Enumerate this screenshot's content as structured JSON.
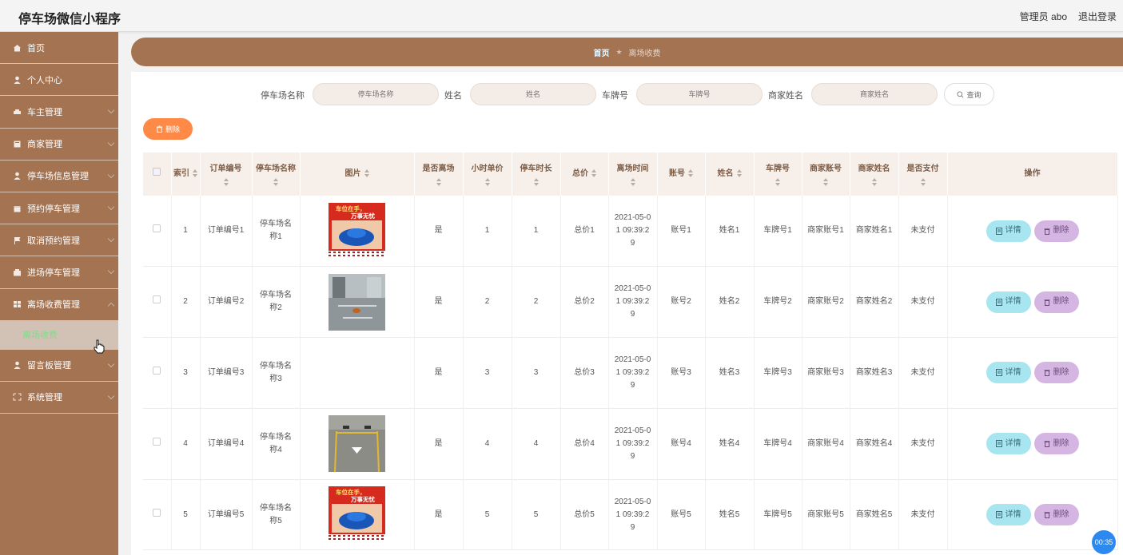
{
  "header": {
    "app_title": "停车场微信小程序",
    "admin_label": "管理员 abo",
    "logout_label": "退出登录"
  },
  "sidebar": {
    "items": [
      {
        "label": "首页",
        "icon": "home-icon"
      },
      {
        "label": "个人中心",
        "icon": "user-icon"
      },
      {
        "label": "车主管理",
        "icon": "car-icon"
      },
      {
        "label": "商家管理",
        "icon": "shop-icon"
      },
      {
        "label": "停车场信息管理",
        "icon": "user-icon"
      },
      {
        "label": "预约停车管理",
        "icon": "calendar-icon"
      },
      {
        "label": "取消预约管理",
        "icon": "flag-icon"
      },
      {
        "label": "进场停车管理",
        "icon": "building-icon"
      },
      {
        "label": "离场收费管理",
        "icon": "grid-icon"
      },
      {
        "label": "留言板管理",
        "icon": "user-icon"
      },
      {
        "label": "系统管理",
        "icon": "settings-icon"
      }
    ],
    "submenu_label": "离场收费"
  },
  "breadcrumb": {
    "home": "首页",
    "separator": "★",
    "current": "离场收费"
  },
  "search": {
    "fields": [
      {
        "label": "停车场名称",
        "placeholder": "停车场名称"
      },
      {
        "label": "姓名",
        "placeholder": "姓名"
      },
      {
        "label": "车牌号",
        "placeholder": "车牌号"
      },
      {
        "label": "商家姓名",
        "placeholder": "商家姓名"
      }
    ],
    "query_label": "查询"
  },
  "toolbar": {
    "delete_label": "删除"
  },
  "table": {
    "columns": [
      "索引",
      "订单编号",
      "停车场名称",
      "图片",
      "是否离场",
      "小时单价",
      "停车时长",
      "总价",
      "离场时间",
      "账号",
      "姓名",
      "车牌号",
      "商家账号",
      "商家姓名",
      "是否支付",
      "操作"
    ],
    "detail_label": "详情",
    "delete_label": "删除",
    "rows": [
      {
        "index": "1",
        "order_no": "订单编号1",
        "lot_name": "停车场名称1",
        "image": "promo",
        "left": "是",
        "unit_price": "1",
        "duration": "1",
        "total": "总价1",
        "leave_time": "2021-05-01 09:39:29",
        "account": "账号1",
        "name": "姓名1",
        "plate": "车牌号1",
        "merchant_account": "商家账号1",
        "merchant_name": "商家姓名1",
        "paid": "未支付"
      },
      {
        "index": "2",
        "order_no": "订单编号2",
        "lot_name": "停车场名称2",
        "image": "garage",
        "left": "是",
        "unit_price": "2",
        "duration": "2",
        "total": "总价2",
        "leave_time": "2021-05-01 09:39:29",
        "account": "账号2",
        "name": "姓名2",
        "plate": "车牌号2",
        "merchant_account": "商家账号2",
        "merchant_name": "商家姓名2",
        "paid": "未支付"
      },
      {
        "index": "3",
        "order_no": "订单编号3",
        "lot_name": "停车场名称3",
        "image": "none",
        "left": "是",
        "unit_price": "3",
        "duration": "3",
        "total": "总价3",
        "leave_time": "2021-05-01 09:39:29",
        "account": "账号3",
        "name": "姓名3",
        "plate": "车牌号3",
        "merchant_account": "商家账号3",
        "merchant_name": "商家姓名3",
        "paid": "未支付"
      },
      {
        "index": "4",
        "order_no": "订单编号4",
        "lot_name": "停车场名称4",
        "image": "spot",
        "left": "是",
        "unit_price": "4",
        "duration": "4",
        "total": "总价4",
        "leave_time": "2021-05-01 09:39:29",
        "account": "账号4",
        "name": "姓名4",
        "plate": "车牌号4",
        "merchant_account": "商家账号4",
        "merchant_name": "商家姓名4",
        "paid": "未支付"
      },
      {
        "index": "5",
        "order_no": "订单编号5",
        "lot_name": "停车场名称5",
        "image": "promo",
        "left": "是",
        "unit_price": "5",
        "duration": "5",
        "total": "总价5",
        "leave_time": "2021-05-01 09:39:29",
        "account": "账号5",
        "name": "姓名5",
        "plate": "车牌号5",
        "merchant_account": "商家账号5",
        "merchant_name": "商家姓名5",
        "paid": "未支付"
      }
    ]
  },
  "promo_image": {
    "line1": "车位在手，",
    "line2": "万事无忧"
  },
  "timer": "00:35",
  "colors": {
    "sidebar": "#a37352",
    "accent_orange": "#ff8a47",
    "detail": "#a7e5f0",
    "delete": "#d5b6e3",
    "submenu_text": "#7edd8a"
  }
}
